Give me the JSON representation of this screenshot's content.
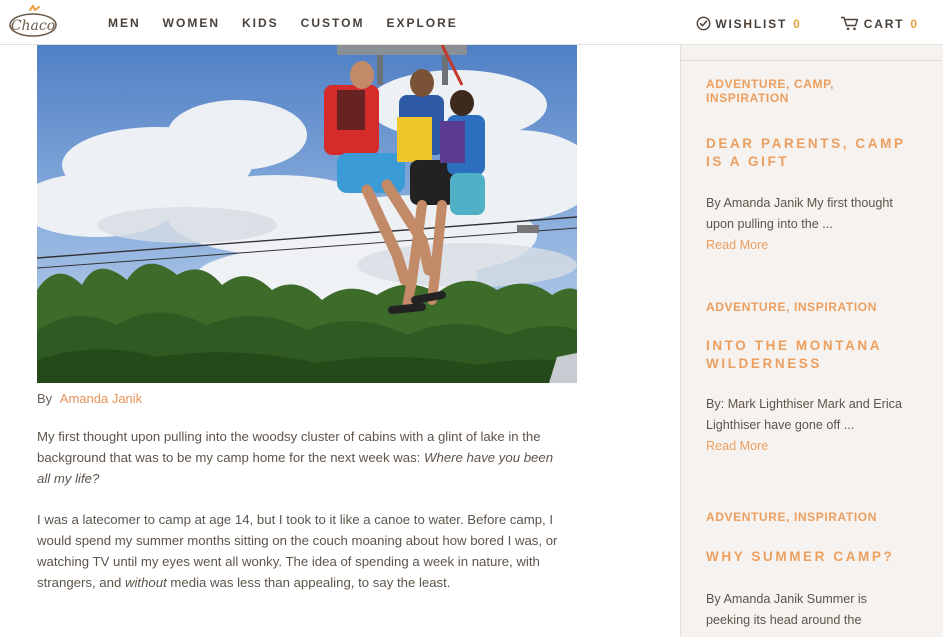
{
  "header": {
    "logo_text": "Chaco",
    "nav": [
      "MEN",
      "WOMEN",
      "KIDS",
      "CUSTOM",
      "EXPLORE"
    ],
    "wishlist_label": "WISHLIST",
    "wishlist_count": "0",
    "cart_label": "CART",
    "cart_count": "0"
  },
  "article": {
    "byline_prefix": "By",
    "author": "Amanda Janik",
    "p1_text": "My first thought upon pulling into the woodsy cluster of cabins with a glint of lake in the background that was to be my camp home for the next week was: ",
    "p1_em": "Where have you been all my life?",
    "p2_before": "I was a latecomer to camp at age 14, but I took to it like a canoe to water. Before camp, I would spend my summer months sitting on the couch moaning about how bored I was, or watching TV until my eyes went all wonky. The idea of spending a week in nature, with strangers, and ",
    "p2_em": "without",
    "p2_after": " media was less than appealing, to say the least."
  },
  "sidebar": {
    "posts": [
      {
        "categories": "ADVENTURE, CAMP, INSPIRATION",
        "title": "DEAR PARENTS, CAMP IS A GIFT",
        "excerpt": "By  Amanda Janik My first thought upon pulling into the ...",
        "read_more": "Read More"
      },
      {
        "categories": "ADVENTURE, INSPIRATION",
        "title": "INTO THE MONTANA WILDERNESS",
        "excerpt": "By: Mark Lighthiser  Mark and Erica Lighthiser have gone off ...",
        "read_more": "Read More"
      },
      {
        "categories": "ADVENTURE, INSPIRATION",
        "title": "WHY SUMMER CAMP?",
        "excerpt": "By Amanda Janik Summer is peeking its head around the"
      }
    ]
  },
  "colors": {
    "accent": "#ec9f5f",
    "count": "#e8a23c",
    "nav_text": "#4a4038",
    "sidebar_bg": "#f6f2ef"
  },
  "icons": {
    "wishlist": "check-circle-icon",
    "cart": "cart-icon"
  }
}
